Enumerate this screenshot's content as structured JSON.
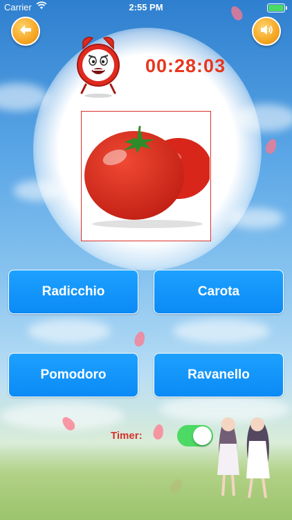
{
  "status_bar": {
    "carrier": "Carrier",
    "time": "2:55 PM"
  },
  "toolbar": {
    "back_icon": "back-arrow-icon",
    "sound_icon": "speaker-icon"
  },
  "timer": {
    "value": "00:28:03",
    "clock_icon": "alarm-clock-icon"
  },
  "question": {
    "image": "tomato-image"
  },
  "answers": [
    {
      "label": "Radicchio"
    },
    {
      "label": "Carota"
    },
    {
      "label": "Pomodoro"
    },
    {
      "label": "Ravanello"
    }
  ],
  "settings": {
    "timer_label": "Timer:",
    "timer_enabled": true
  },
  "colors": {
    "accent_orange": "#F5A623",
    "button_blue": "#0B8AF5",
    "timer_red": "#E8361D",
    "toggle_green": "#4CD964"
  }
}
